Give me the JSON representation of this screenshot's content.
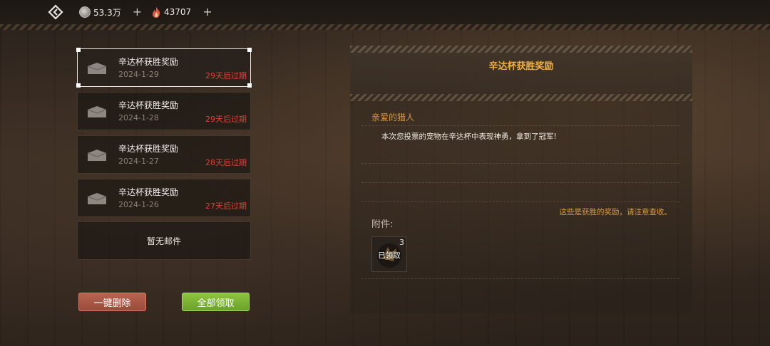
{
  "topbar": {
    "back_icon": "back-diamond-icon",
    "currency1": {
      "icon": "silver-coin-icon",
      "value": "53.3万",
      "plus": "+"
    },
    "currency2": {
      "icon": "flame-icon",
      "value": "43707",
      "plus": "+"
    }
  },
  "mail_list": {
    "items": [
      {
        "title": "辛达杯获胜奖励",
        "date": "2024-1-29",
        "expire": "29天后过期",
        "selected": true
      },
      {
        "title": "辛达杯获胜奖励",
        "date": "2024-1-28",
        "expire": "29天后过期",
        "selected": false
      },
      {
        "title": "辛达杯获胜奖励",
        "date": "2024-1-27",
        "expire": "28天后过期",
        "selected": false
      },
      {
        "title": "辛达杯获胜奖励",
        "date": "2024-1-26",
        "expire": "27天后过期",
        "selected": false
      }
    ],
    "empty_label": "暂无邮件",
    "delete_all_label": "一键删除",
    "collect_all_label": "全部领取"
  },
  "detail": {
    "title": "辛达杯获胜奖励",
    "greeting": "亲爱的猎人",
    "body": "本次您投票的宠物在辛达杯中表现神勇，拿到了冠军!",
    "footnote": "这些是获胜的奖励，请注意查收。",
    "attachments_label": "附件:",
    "attachment": {
      "count": "3",
      "status": "已领取"
    }
  },
  "colors": {
    "accent_gold": "#f1b13b",
    "expire_red": "#e0413a",
    "delete_button": "#b96350",
    "collect_button": "#8ec43d"
  }
}
